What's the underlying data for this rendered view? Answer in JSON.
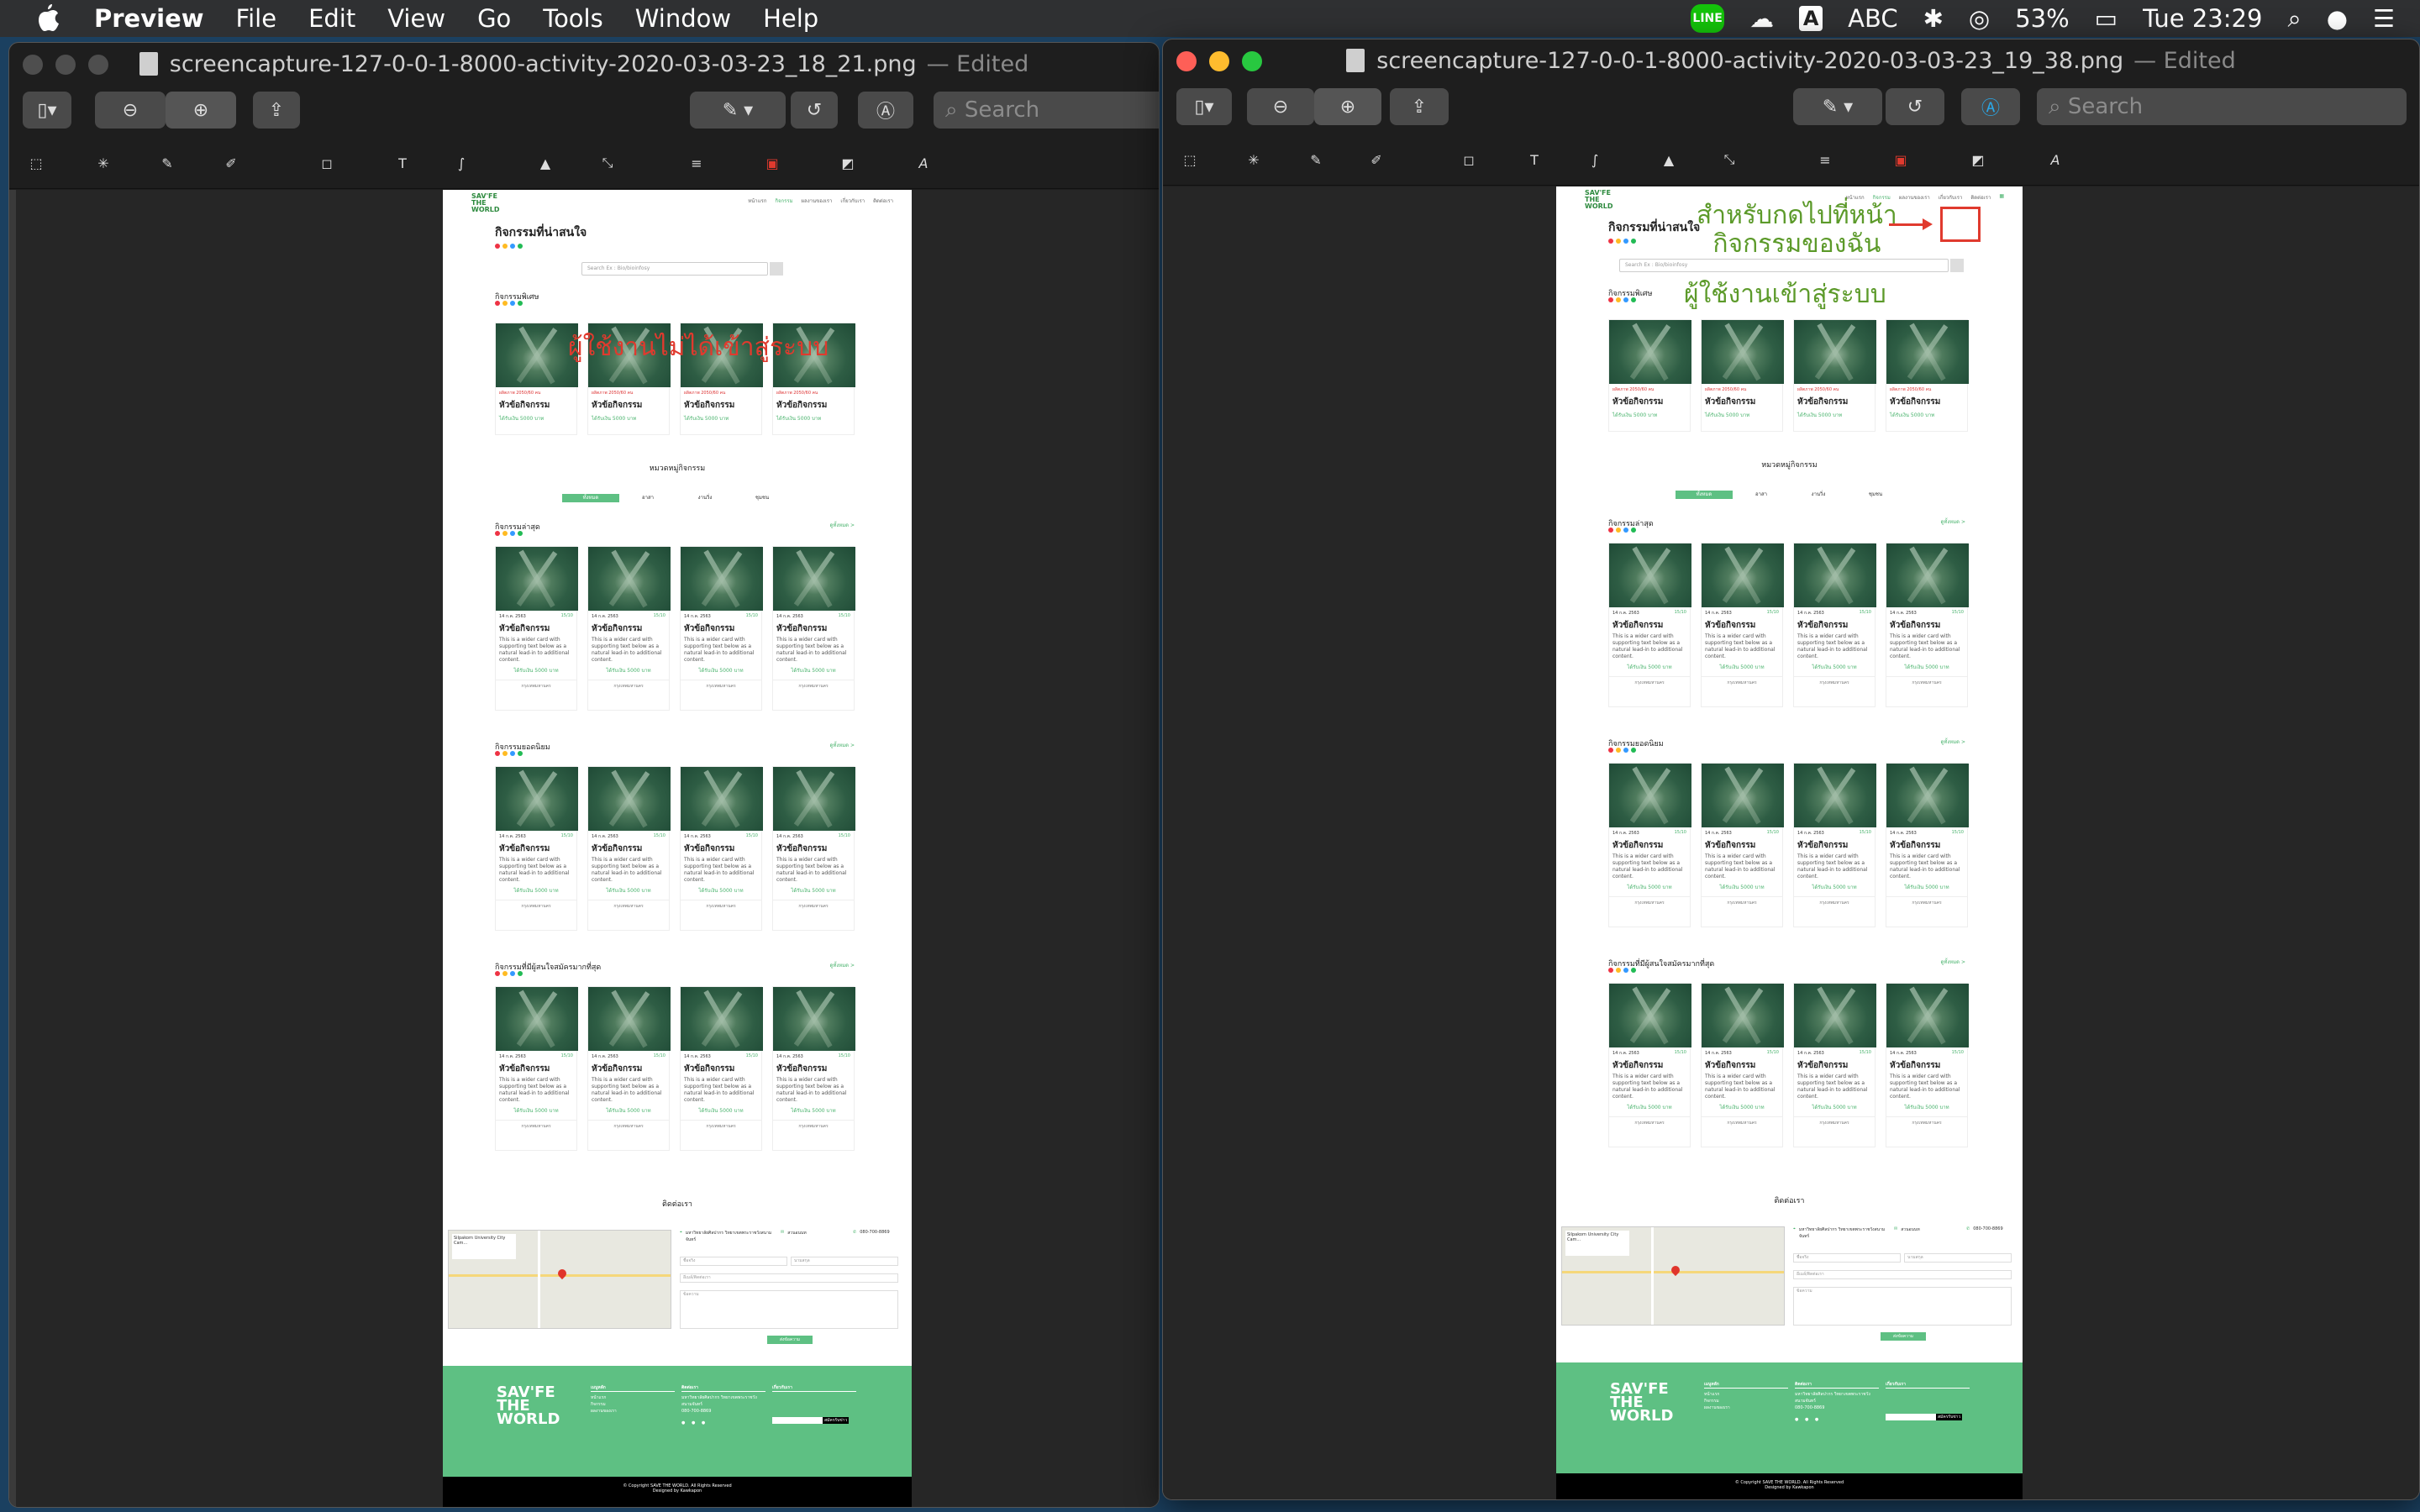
{
  "menubar": {
    "app": "Preview",
    "items": [
      "File",
      "Edit",
      "View",
      "Go",
      "Tools",
      "Window",
      "Help"
    ],
    "status": {
      "input": "ABC",
      "battery": "53%",
      "clock": "Tue 23:29",
      "line_badge": "LINE",
      "input_badge": "A"
    }
  },
  "windows": {
    "left": {
      "title": "screencapture-127-0-0-1-8000-activity-2020-03-03-23_18_21.png",
      "edited": "— Edited",
      "search_placeholder": "Search",
      "annotation": "ผู้ใช้งานไม่ได้เข้าสู่ระบบ"
    },
    "right": {
      "title": "screencapture-127-0-0-1-8000-activity-2020-03-03-23_19_38.png",
      "edited": "— Edited",
      "search_placeholder": "Search",
      "annotation": "ผู้ใช้งานเข้าสู่ระบบ",
      "callout_line1": "สำหรับกดไปที่หน้า",
      "callout_line2": "กิจกรรมของฉัน"
    }
  },
  "site": {
    "brand": "SAV'FE THE WORLD",
    "nav": [
      "หน้าแรก",
      "กิจกรรม",
      "ผลงานของเรา",
      "เกี่ยวกับเรา",
      "ติดต่อเรา"
    ],
    "page_title": "กิจกรรมที่น่าสนใจ",
    "search_placeholder": "Search Ex : Bio/bioinfosy",
    "section_recommended": "กิจกรรมพิเศษ",
    "category_title": "หมวดหมู่กิจกรรม",
    "category_tabs": [
      "ทั้งหมด",
      "อาสา",
      "งานวิ่ง",
      "ชุมชน"
    ],
    "see_all": "ดูทั้งหมด >",
    "sections": [
      "กิจกรรมล่าสุด",
      "กิจกรรมยอดนิยม",
      "กิจกรรมที่มีผู้สนใจสมัครมากที่สุด"
    ],
    "card": {
      "meta": "ผลิตภาพ 2050/60 คน",
      "date": "14 ก.ค. 2563",
      "count": "15/10",
      "title": "หัวข้อกิจกรรม",
      "desc": "This is a wider card with supporting text below as a natural lead-in to additional content.",
      "price": "ได้รับเงิน 5000 บาท",
      "location": "กรุงเทพมหานคร"
    },
    "contact": {
      "title": "ติดต่อเรา",
      "address": "มหาวิทยาลัยศิลปากร วิทยาเขตพระราชวังสนามจันทร์",
      "email": "สวนอนนท",
      "phone": "080-700-8869",
      "map_place": "Silpakorn University City Cam...",
      "fields": [
        "ชื่อจริง",
        "นามสกุล",
        "อีเมล์/ติดต่อเรา",
        "ข้อความ"
      ],
      "send": "ส่งข้อความ"
    },
    "footer": {
      "col1_title": "เมนูหลัก",
      "col1": [
        "หน้าแรก",
        "กิจกรรม",
        "ผลงานของเรา"
      ],
      "col2_title": "ติดต่อเรา",
      "col3_title": "เกี่ยวกับเรา",
      "subscribe": "สมัครรับข่าว",
      "copyright": "© Copyright SAVE THE WORLD. All Rights Reserved",
      "designed": "Designed by Kawkapon"
    }
  },
  "colors": {
    "accent": "#5ec083",
    "annotation_red": "#e03a2e",
    "annotation_green": "#5c9a2a"
  }
}
